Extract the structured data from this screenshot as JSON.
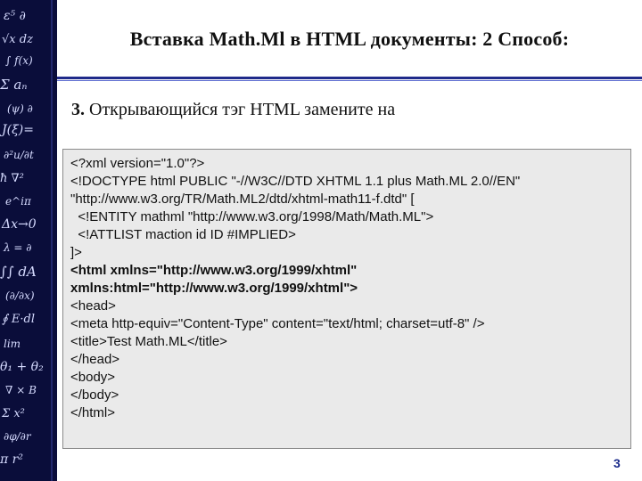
{
  "slide": {
    "title": "Вставка Math.Ml в HTML документы: 2 Способ:",
    "subtitle_number": "3.",
    "subtitle_text": " Открывающийся тэг HTML замените на",
    "page_number": "3"
  },
  "code_lines": [
    {
      "text": "<?xml version=\"1.0\"?>",
      "bold": false
    },
    {
      "text": "<!DOCTYPE html PUBLIC \"-//W3C//DTD XHTML 1.1 plus Math.ML 2.0//EN\"",
      "bold": false
    },
    {
      "text": "\"http://www.w3.org/TR/Math.ML2/dtd/xhtml-math11-f.dtd\" [",
      "bold": false
    },
    {
      "text": "  <!ENTITY mathml \"http://www.w3.org/1998/Math/Math.ML\">",
      "bold": false
    },
    {
      "text": "  <!ATTLIST maction id ID #IMPLIED>",
      "bold": false
    },
    {
      "text": "]>",
      "bold": false
    },
    {
      "text": "<html xmlns=\"http://www.w3.org/1999/xhtml\"",
      "bold": true
    },
    {
      "text": "xmlns:html=\"http://www.w3.org/1999/xhtml\">",
      "bold": true
    },
    {
      "text": "<head>",
      "bold": false
    },
    {
      "text": "<meta http-equiv=\"Content-Type\" content=\"text/html; charset=utf-8\" />",
      "bold": false
    },
    {
      "text": "<title>Test Math.ML</title>",
      "bold": false
    },
    {
      "text": "</head>",
      "bold": false
    },
    {
      "text": "<body>",
      "bold": false
    },
    {
      "text": "</body>",
      "bold": false
    },
    {
      "text": "</html>",
      "bold": false
    }
  ],
  "colors": {
    "strip": "#0a0d3a",
    "accent": "#1f2a8a",
    "code_bg": "#eaeaea"
  }
}
